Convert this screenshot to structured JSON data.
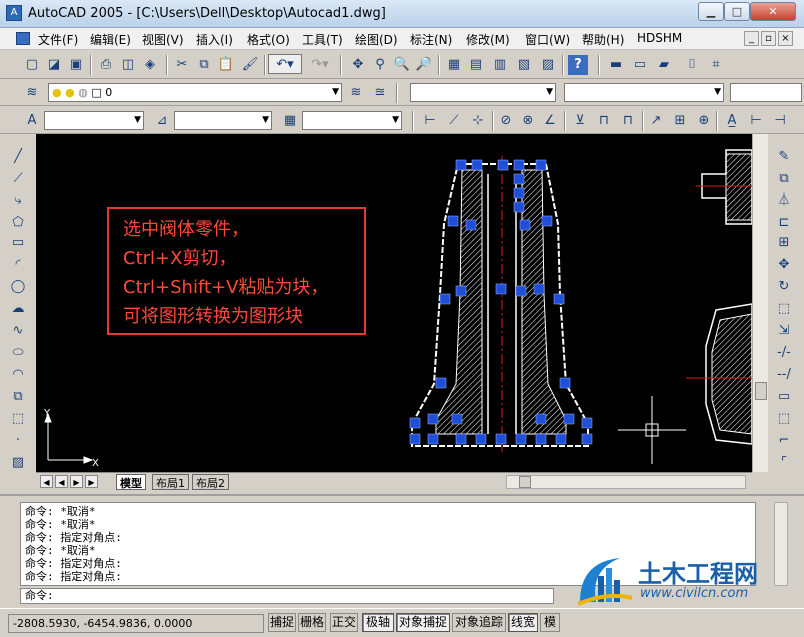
{
  "window": {
    "title": "AutoCAD 2005 - [C:\\Users\\Dell\\Desktop\\Autocad1.dwg]",
    "app_icon": "autocad-icon",
    "controls": [
      "minimize-icon",
      "maximize-icon",
      "close-icon"
    ]
  },
  "menu": {
    "items": [
      "文件(F)",
      "编辑(E)",
      "视图(V)",
      "插入(I)",
      "格式(O)",
      "工具(T)",
      "绘图(D)",
      "标注(N)",
      "修改(M)",
      "窗口(W)",
      "帮助(H)",
      "HDSHM"
    ]
  },
  "layer_toolbar": {
    "layer_value": "0"
  },
  "callout": {
    "lines": [
      "选中阀体零件，",
      "Ctrl+X剪切，",
      "Ctrl+Shift+V粘贴为块，",
      "可将图形转换为图形块"
    ],
    "color": "#e23a2b"
  },
  "ucs": {
    "x_label": "X",
    "y_label": "Y"
  },
  "layout_tabs": [
    "模型",
    "布局1",
    "布局2"
  ],
  "command": {
    "history": [
      "命令: *取消*",
      "命令: *取消*",
      "命令: 指定对角点:",
      "命令: *取消*",
      "命令: 指定对角点:",
      "命令: 指定对角点:"
    ],
    "prompt": "命令:"
  },
  "status": {
    "coordinates": "-2808.5930, -6454.9836, 0.0000",
    "buttons": [
      "捕捉",
      "栅格",
      "正交",
      "极轴",
      "对象捕捉",
      "对象追踪",
      "线宽",
      "模"
    ]
  },
  "watermark": {
    "title": "土木工程网",
    "url": "www.civilcn.com"
  },
  "colors": {
    "canvas_bg": "#000000",
    "grip_blue": "#1f4fd8",
    "drawing_white": "#ffffff",
    "centerline_red": "#d42020"
  }
}
